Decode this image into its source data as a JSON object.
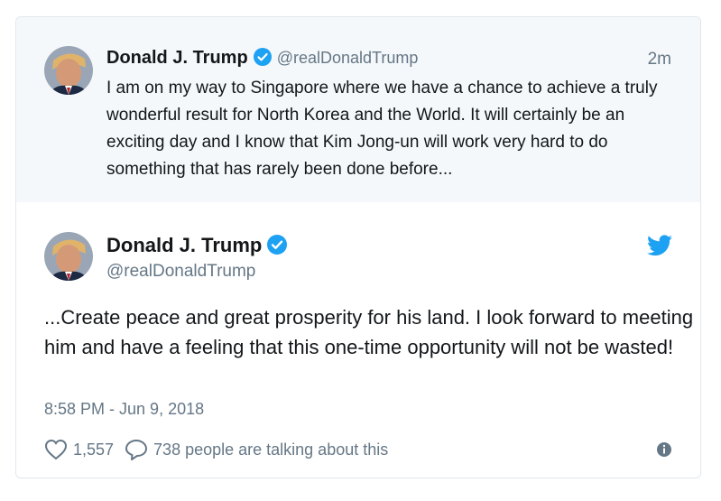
{
  "quoted_tweet": {
    "author_name": "Donald J. Trump",
    "handle": "@realDonaldTrump",
    "time": "2m",
    "text": "I am on my way to Singapore where we have a chance to achieve a truly wonderful result for North Korea and the World. It will certainly be an exciting day and I know that Kim Jong-un will work very hard to do something that has rarely been done before..."
  },
  "main_tweet": {
    "author_name": "Donald J. Trump",
    "handle": "@realDonaldTrump",
    "text": "...Create peace and great prosperity for his land. I look forward to meeting him and have a feeling that this one-time opportunity will not be wasted!",
    "timestamp": "8:58 PM - Jun 9, 2018",
    "likes": "1,557",
    "talking": "738 people are talking about this"
  },
  "colors": {
    "brand": "#1da1f2",
    "muted": "#657786",
    "quoted_bg": "#f5f8fa"
  },
  "icons": {
    "verified": "verified-badge-icon",
    "bird": "twitter-bird-icon",
    "like": "heart-icon",
    "reply": "comment-icon",
    "info": "info-icon"
  }
}
